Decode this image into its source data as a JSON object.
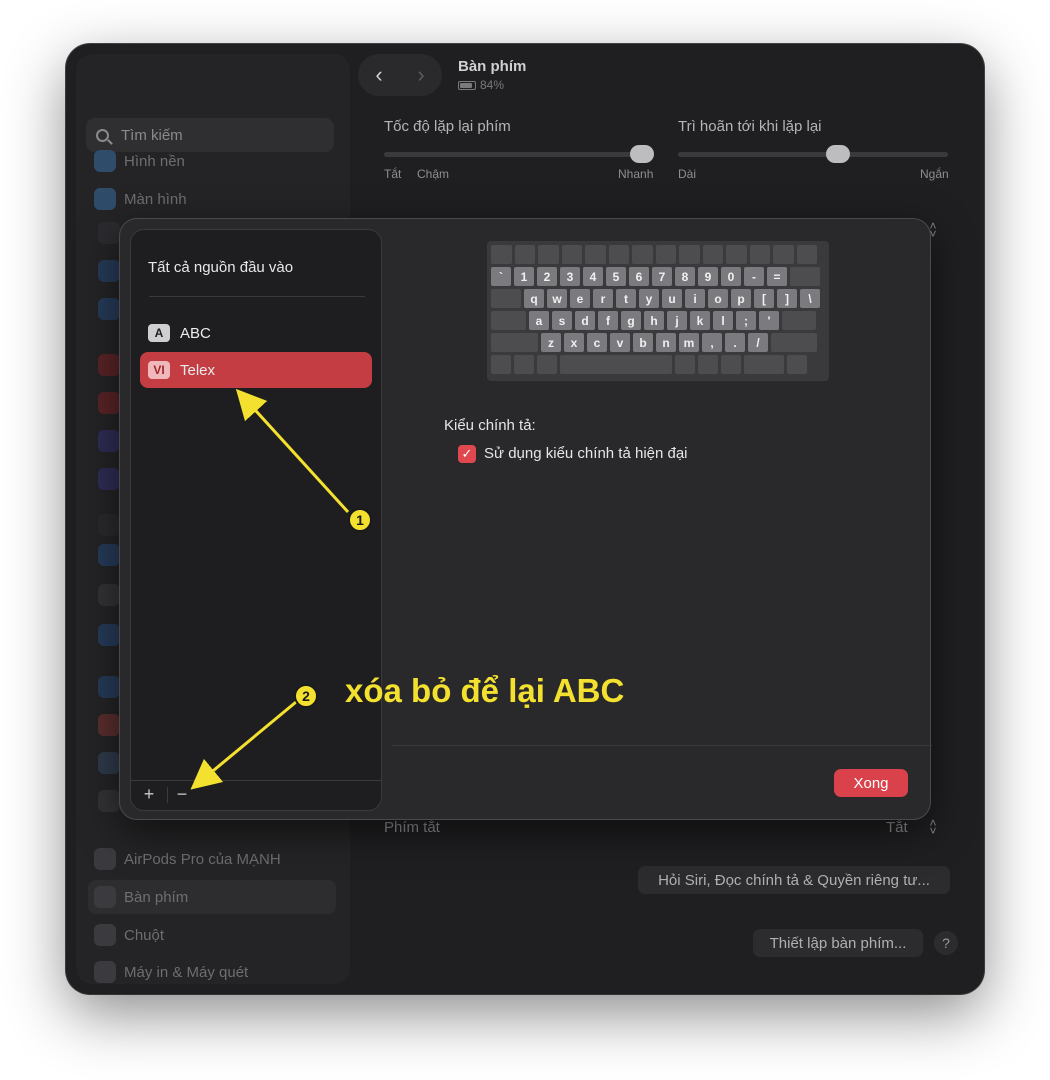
{
  "window": {
    "title": "Bàn phím",
    "battery": "84%"
  },
  "sidebar": {
    "search_placeholder": "Tìm kiếm",
    "items_top": [
      "Hình nền",
      "Màn hình"
    ],
    "items_bottom": [
      "AirPods Pro của MẠNH",
      "Bàn phím",
      "Chuột",
      "Máy in & Máy quét"
    ],
    "active": "Bàn phím"
  },
  "settings": {
    "repeat_rate": {
      "label": "Tốc độ lặp lại phím",
      "left": "Tắt",
      "left2": "Chậm",
      "right": "Nhanh",
      "value": 1.0
    },
    "repeat_delay": {
      "label": "Trì hoãn tới khi lặp lại",
      "left": "Dài",
      "right": "Ngắn",
      "value": 0.6
    },
    "shortcut_label": "Phím tắt",
    "shortcut_value": "Tắt",
    "siri_button": "Hỏi Siri, Đọc chính tả & Quyền riêng tư...",
    "keyboard_setup_button": "Thiết lập bàn phím...",
    "help": "?"
  },
  "sheet": {
    "panel_title": "Tất cả nguồn đầu vào",
    "sources": [
      {
        "badge": "A",
        "name": "ABC",
        "selected": false
      },
      {
        "badge": "VI",
        "name": "Telex",
        "selected": true
      }
    ],
    "add": "+",
    "remove": "−",
    "spelling_label": "Kiểu chính tả:",
    "modern_spelling": "Sử dụng kiểu chính tả hiện đại",
    "modern_spelling_checked": true,
    "done": "Xong"
  },
  "keyboard": {
    "row1": [
      "`",
      "1",
      "2",
      "3",
      "4",
      "5",
      "6",
      "7",
      "8",
      "9",
      "0",
      "-",
      "="
    ],
    "row2": [
      "q",
      "w",
      "e",
      "r",
      "t",
      "y",
      "u",
      "i",
      "o",
      "p",
      "[",
      "]",
      "\\"
    ],
    "row3": [
      "a",
      "s",
      "d",
      "f",
      "g",
      "h",
      "j",
      "k",
      "l",
      ";",
      "'"
    ],
    "row4": [
      "z",
      "x",
      "c",
      "v",
      "b",
      "n",
      "m",
      ",",
      ".",
      "/"
    ]
  },
  "annotations": {
    "step1": "1",
    "step2": "2",
    "note": "xóa bỏ để lại ABC",
    "color": "#f4e12f"
  }
}
